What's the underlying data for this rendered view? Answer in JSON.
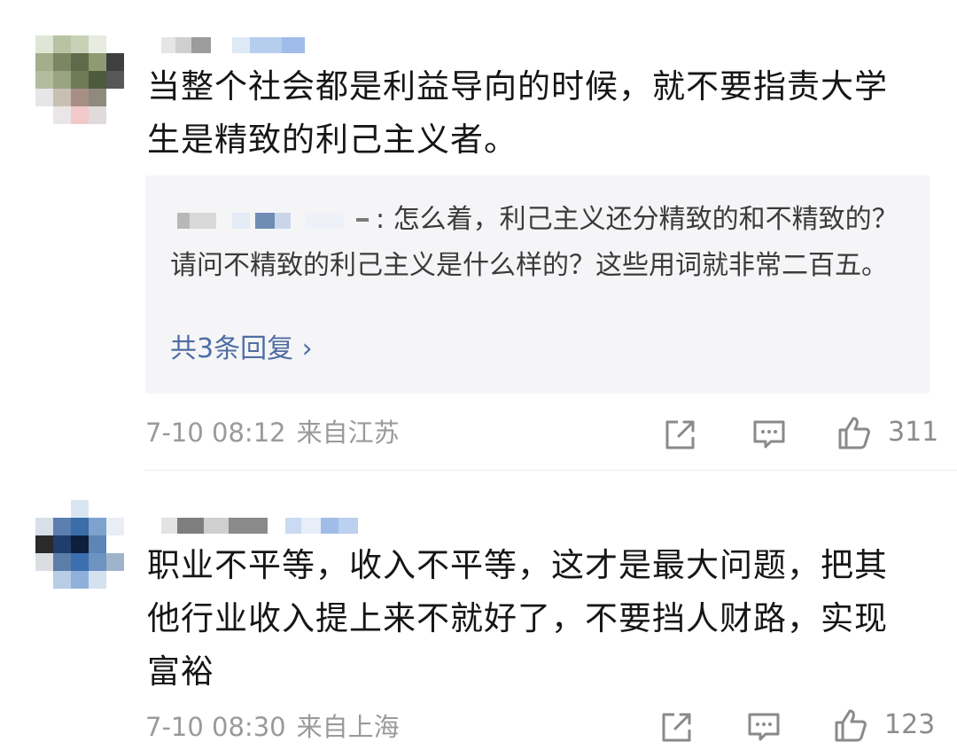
{
  "comments": [
    {
      "text": "当整个社会都是利益导向的时候，就不要指责大学生是精致的利己主义者。",
      "reply": {
        "text": ": 怎么着，利己主义还分精致的和不精致的？请问不精致的利己主义是什么样的？这些用词就非常二百五。",
        "more": "共3条回复 ›"
      },
      "time": "7-10 08:12",
      "location": "来自江苏",
      "likes": "311"
    },
    {
      "text": "职业不平等，收入不平等，这才是最大问题，把其他行业收入提上来不就好了，不要挡人财路，实现富裕",
      "time": "7-10 08:30",
      "location": "来自上海",
      "likes": "123"
    }
  ],
  "icons": {
    "share": "share-icon",
    "comment": "comment-icon",
    "like": "thumbs-up-icon"
  },
  "colors": {
    "link": "#4f6da3",
    "meta": "#9a9a9a",
    "reply_bg": "#f5f5f7"
  }
}
